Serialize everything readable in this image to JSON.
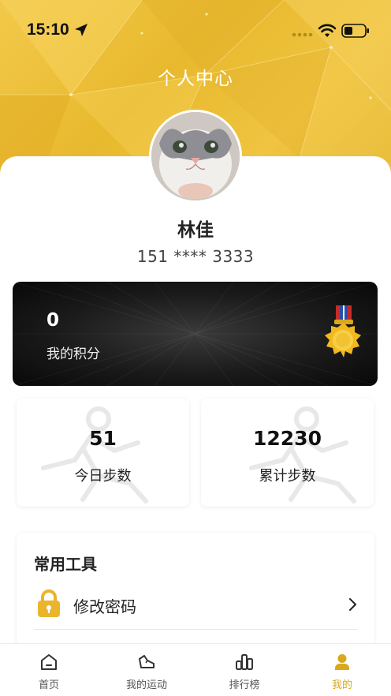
{
  "status_bar": {
    "time": "15:10"
  },
  "header": {
    "title": "个人中心"
  },
  "profile": {
    "name": "林佳",
    "phone": "151 **** 3333"
  },
  "points": {
    "value": "0",
    "label": "我的积分"
  },
  "stats": [
    {
      "value": "51",
      "label": "今日步数"
    },
    {
      "value": "12230",
      "label": "累计步数"
    }
  ],
  "tools": {
    "title": "常用工具",
    "items": [
      {
        "label": "修改密码",
        "icon": "lock-icon"
      }
    ]
  },
  "tab_bar": {
    "tabs": [
      {
        "label": "首页",
        "icon": "home-icon",
        "active": false
      },
      {
        "label": "我的运动",
        "icon": "shoe-icon",
        "active": false
      },
      {
        "label": "排行榜",
        "icon": "ranking-icon",
        "active": false
      },
      {
        "label": "我的",
        "icon": "user-icon",
        "active": true
      }
    ]
  },
  "colors": {
    "accent": "#e8b92e",
    "active_tab": "#d9a81d",
    "points_card": "#111111"
  }
}
